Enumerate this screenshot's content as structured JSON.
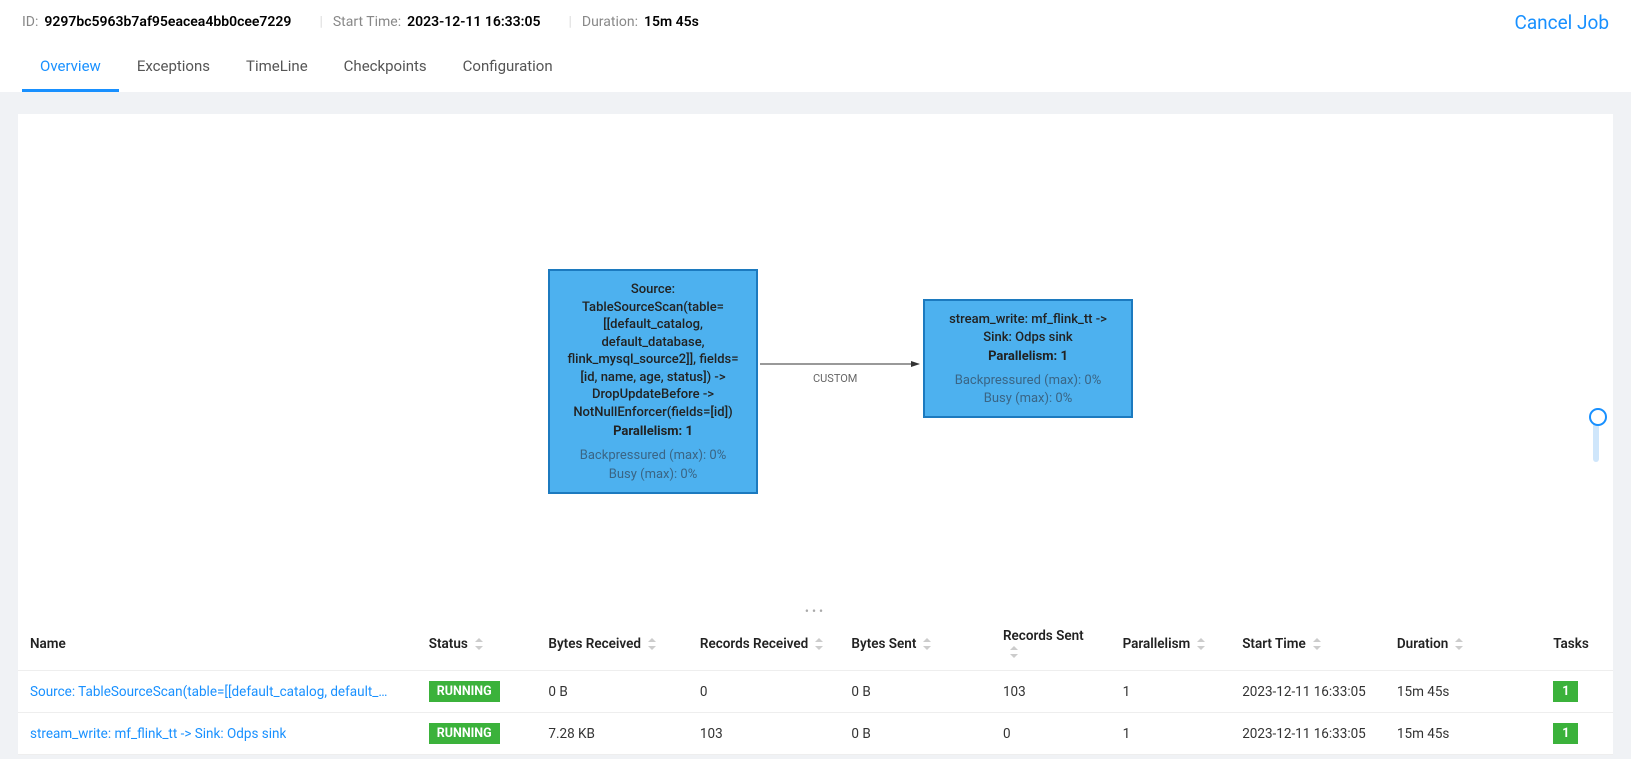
{
  "header": {
    "id_label": "ID:",
    "id_value": "9297bc5963b7af95eacea4bb0cee7229",
    "start_label": "Start Time:",
    "start_value": "2023-12-11 16:33:05",
    "duration_label": "Duration:",
    "duration_value": "15m 45s",
    "cancel_label": "Cancel Job"
  },
  "tabs": {
    "overview": "Overview",
    "exceptions": "Exceptions",
    "timeline": "TimeLine",
    "checkpoints": "Checkpoints",
    "configuration": "Configuration"
  },
  "graph": {
    "edge_type": "CUSTOM",
    "node1": {
      "title": "Source: TableSourceScan(table=[[default_catalog, default_database, flink_mysql_source2]], fields=[id, name, age, status]) -> DropUpdateBefore -> NotNullEnforcer(fields=[id])",
      "parallelism": "Parallelism: 1",
      "backpressure": "Backpressured (max): 0%",
      "busy": "Busy (max): 0%"
    },
    "node2": {
      "title": "stream_write: mf_flink_tt -> Sink: Odps sink",
      "parallelism": "Parallelism: 1",
      "backpressure": "Backpressured (max): 0%",
      "busy": "Busy (max): 0%"
    }
  },
  "table": {
    "headers": {
      "name": "Name",
      "status": "Status",
      "bytes_received": "Bytes Received",
      "records_received": "Records Received",
      "bytes_sent": "Bytes Sent",
      "records_sent": "Records Sent",
      "parallelism": "Parallelism",
      "start_time": "Start Time",
      "duration": "Duration",
      "tasks": "Tasks"
    },
    "rows": [
      {
        "name": "Source: TableSourceScan(table=[[default_catalog, default_database, fli...",
        "status": "RUNNING",
        "bytes_received": "0 B",
        "records_received": "0",
        "bytes_sent": "0 B",
        "records_sent": "103",
        "parallelism": "1",
        "start_time": "2023-12-11 16:33:05",
        "duration": "15m 45s",
        "tasks": "1"
      },
      {
        "name": "stream_write: mf_flink_tt -> Sink: Odps sink",
        "status": "RUNNING",
        "bytes_received": "7.28 KB",
        "records_received": "103",
        "bytes_sent": "0 B",
        "records_sent": "0",
        "parallelism": "1",
        "start_time": "2023-12-11 16:33:05",
        "duration": "15m 45s",
        "tasks": "1"
      }
    ]
  }
}
